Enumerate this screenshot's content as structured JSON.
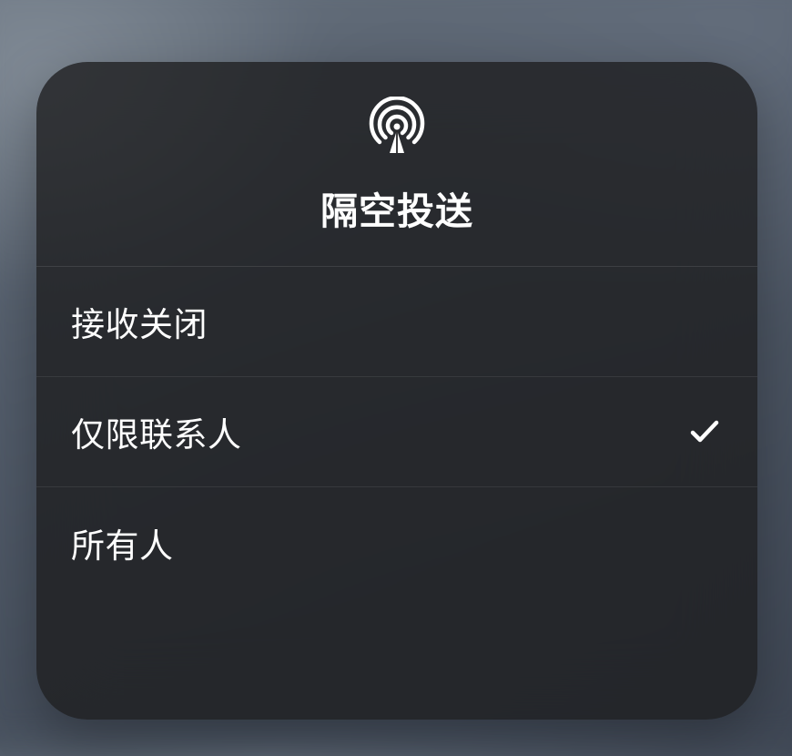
{
  "panel": {
    "title": "隔空投送",
    "icon": "airdrop-icon"
  },
  "options": [
    {
      "label": "接收关闭",
      "selected": false
    },
    {
      "label": "仅限联系人",
      "selected": true
    },
    {
      "label": "所有人",
      "selected": false
    }
  ]
}
